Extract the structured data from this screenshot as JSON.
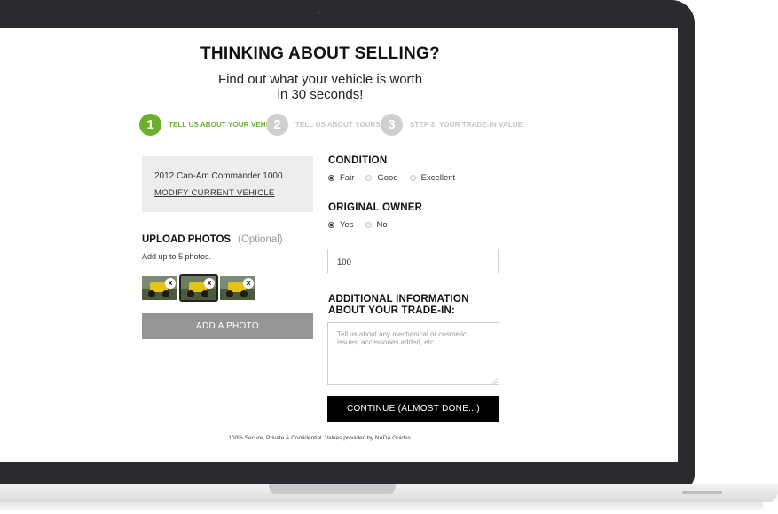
{
  "header": {
    "title": "THINKING ABOUT SELLING?",
    "subtitle_line1": "Find out what your vehicle is worth",
    "subtitle_line2": "in 30 seconds!"
  },
  "steps": [
    {
      "number": "1",
      "label": "TELL US ABOUT YOUR VEHICLE",
      "active": true
    },
    {
      "number": "2",
      "label": "TELL US ABOUT YOURSELF",
      "active": false
    },
    {
      "number": "3",
      "label": "STEP 3: YOUR TRADE-IN VALUE",
      "active": false
    }
  ],
  "vehicle": {
    "name": "2012 Can-Am Commander 1000",
    "modify_label": "MODIFY CURRENT VEHICLE"
  },
  "upload": {
    "title": "UPLOAD PHOTOS",
    "optional": "(Optional)",
    "hint": "Add up to 5 photos.",
    "remove_glyph": "×",
    "add_button": "ADD A PHOTO"
  },
  "condition": {
    "label": "CONDITION",
    "options": [
      "Fair",
      "Good",
      "Excellent"
    ],
    "selected": "Fair"
  },
  "original_owner": {
    "label": "ORIGINAL OWNER",
    "options": [
      "Yes",
      "No"
    ],
    "selected": "Yes"
  },
  "mileage_input": {
    "value": "100"
  },
  "additional_info": {
    "label": "ADDITIONAL INFORMATION ABOUT YOUR TRADE-IN:",
    "placeholder": "Tell us about any mechanical or cosmetic issues, accessories added, etc."
  },
  "continue_button": "CONTINUE (ALMOST DONE...)",
  "footer": "100% Secure, Private & Confidential. Values provided by NADA Guides.",
  "colors": {
    "accent_green": "#6ab02b",
    "inactive_gray": "#cfcfcf",
    "button_black": "#000000",
    "button_gray": "#959595",
    "bezel": "#2a2b2f"
  },
  "icons": {
    "remove_photo": "close-circle-icon",
    "camera": "webcam-icon"
  }
}
